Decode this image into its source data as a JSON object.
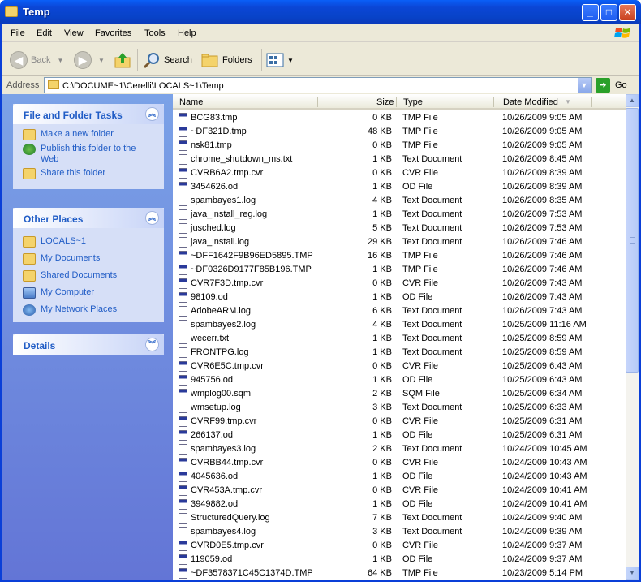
{
  "window": {
    "title": "Temp",
    "min": "_",
    "max": "□",
    "close": "✕"
  },
  "menu": [
    "File",
    "Edit",
    "View",
    "Favorites",
    "Tools",
    "Help"
  ],
  "toolbar": {
    "back": "Back",
    "search": "Search",
    "folders": "Folders"
  },
  "address": {
    "label": "Address",
    "path": "C:\\DOCUME~1\\Cerelli\\LOCALS~1\\Temp",
    "go": "Go"
  },
  "panels": {
    "tasks": {
      "title": "File and Folder Tasks",
      "items": [
        "Make a new folder",
        "Publish this folder to the Web",
        "Share this folder"
      ]
    },
    "places": {
      "title": "Other Places",
      "items": [
        "LOCALS~1",
        "My Documents",
        "Shared Documents",
        "My Computer",
        "My Network Places"
      ]
    },
    "details": {
      "title": "Details"
    }
  },
  "columns": {
    "name": "Name",
    "size": "Size",
    "type": "Type",
    "date": "Date Modified"
  },
  "files": [
    {
      "name": "BCG83.tmp",
      "size": "0 KB",
      "type": "TMP File",
      "date": "10/26/2009 9:05 AM",
      "icon": "app"
    },
    {
      "name": "~DF321D.tmp",
      "size": "48 KB",
      "type": "TMP File",
      "date": "10/26/2009 9:05 AM",
      "icon": "app"
    },
    {
      "name": "nsk81.tmp",
      "size": "0 KB",
      "type": "TMP File",
      "date": "10/26/2009 9:05 AM",
      "icon": "app"
    },
    {
      "name": "chrome_shutdown_ms.txt",
      "size": "1 KB",
      "type": "Text Document",
      "date": "10/26/2009 8:45 AM",
      "icon": "txt"
    },
    {
      "name": "CVRB6A2.tmp.cvr",
      "size": "0 KB",
      "type": "CVR File",
      "date": "10/26/2009 8:39 AM",
      "icon": "app"
    },
    {
      "name": "3454626.od",
      "size": "1 KB",
      "type": "OD File",
      "date": "10/26/2009 8:39 AM",
      "icon": "app"
    },
    {
      "name": "spambayes1.log",
      "size": "4 KB",
      "type": "Text Document",
      "date": "10/26/2009 8:35 AM",
      "icon": "txt"
    },
    {
      "name": "java_install_reg.log",
      "size": "1 KB",
      "type": "Text Document",
      "date": "10/26/2009 7:53 AM",
      "icon": "txt"
    },
    {
      "name": "jusched.log",
      "size": "5 KB",
      "type": "Text Document",
      "date": "10/26/2009 7:53 AM",
      "icon": "txt"
    },
    {
      "name": "java_install.log",
      "size": "29 KB",
      "type": "Text Document",
      "date": "10/26/2009 7:46 AM",
      "icon": "txt"
    },
    {
      "name": "~DFF1642F9B96ED5895.TMP",
      "size": "16 KB",
      "type": "TMP File",
      "date": "10/26/2009 7:46 AM",
      "icon": "app"
    },
    {
      "name": "~DF0326D9177F85B196.TMP",
      "size": "1 KB",
      "type": "TMP File",
      "date": "10/26/2009 7:46 AM",
      "icon": "app"
    },
    {
      "name": "CVR7F3D.tmp.cvr",
      "size": "0 KB",
      "type": "CVR File",
      "date": "10/26/2009 7:43 AM",
      "icon": "app"
    },
    {
      "name": "98109.od",
      "size": "1 KB",
      "type": "OD File",
      "date": "10/26/2009 7:43 AM",
      "icon": "app"
    },
    {
      "name": "AdobeARM.log",
      "size": "6 KB",
      "type": "Text Document",
      "date": "10/26/2009 7:43 AM",
      "icon": "txt"
    },
    {
      "name": "spambayes2.log",
      "size": "4 KB",
      "type": "Text Document",
      "date": "10/25/2009 11:16 AM",
      "icon": "txt"
    },
    {
      "name": "wecerr.txt",
      "size": "1 KB",
      "type": "Text Document",
      "date": "10/25/2009 8:59 AM",
      "icon": "txt"
    },
    {
      "name": "FRONTPG.log",
      "size": "1 KB",
      "type": "Text Document",
      "date": "10/25/2009 8:59 AM",
      "icon": "txt"
    },
    {
      "name": "CVR6E5C.tmp.cvr",
      "size": "0 KB",
      "type": "CVR File",
      "date": "10/25/2009 6:43 AM",
      "icon": "app"
    },
    {
      "name": "945756.od",
      "size": "1 KB",
      "type": "OD File",
      "date": "10/25/2009 6:43 AM",
      "icon": "app"
    },
    {
      "name": "wmplog00.sqm",
      "size": "2 KB",
      "type": "SQM File",
      "date": "10/25/2009 6:34 AM",
      "icon": "app"
    },
    {
      "name": "wmsetup.log",
      "size": "3 KB",
      "type": "Text Document",
      "date": "10/25/2009 6:33 AM",
      "icon": "txt"
    },
    {
      "name": "CVRF99.tmp.cvr",
      "size": "0 KB",
      "type": "CVR File",
      "date": "10/25/2009 6:31 AM",
      "icon": "app"
    },
    {
      "name": "266137.od",
      "size": "1 KB",
      "type": "OD File",
      "date": "10/25/2009 6:31 AM",
      "icon": "app"
    },
    {
      "name": "spambayes3.log",
      "size": "2 KB",
      "type": "Text Document",
      "date": "10/24/2009 10:45 AM",
      "icon": "txt"
    },
    {
      "name": "CVRBB44.tmp.cvr",
      "size": "0 KB",
      "type": "CVR File",
      "date": "10/24/2009 10:43 AM",
      "icon": "app"
    },
    {
      "name": "4045636.od",
      "size": "1 KB",
      "type": "OD File",
      "date": "10/24/2009 10:43 AM",
      "icon": "app"
    },
    {
      "name": "CVR453A.tmp.cvr",
      "size": "0 KB",
      "type": "CVR File",
      "date": "10/24/2009 10:41 AM",
      "icon": "app"
    },
    {
      "name": "3949882.od",
      "size": "1 KB",
      "type": "OD File",
      "date": "10/24/2009 10:41 AM",
      "icon": "app"
    },
    {
      "name": "StructuredQuery.log",
      "size": "7 KB",
      "type": "Text Document",
      "date": "10/24/2009 9:40 AM",
      "icon": "txt"
    },
    {
      "name": "spambayes4.log",
      "size": "3 KB",
      "type": "Text Document",
      "date": "10/24/2009 9:39 AM",
      "icon": "txt"
    },
    {
      "name": "CVRD0E5.tmp.cvr",
      "size": "0 KB",
      "type": "CVR File",
      "date": "10/24/2009 9:37 AM",
      "icon": "app"
    },
    {
      "name": "119059.od",
      "size": "1 KB",
      "type": "OD File",
      "date": "10/24/2009 9:37 AM",
      "icon": "app"
    },
    {
      "name": "~DF3578371C45C1374D.TMP",
      "size": "64 KB",
      "type": "TMP File",
      "date": "10/23/2009 5:14 PM",
      "icon": "app"
    }
  ]
}
